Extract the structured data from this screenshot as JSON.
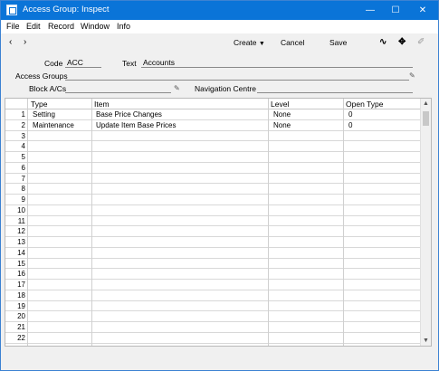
{
  "window": {
    "title": "Access Group: Inspect"
  },
  "menu": [
    "File",
    "Edit",
    "Record",
    "Window",
    "Info"
  ],
  "toolbar": {
    "back": "‹",
    "forward": "›",
    "create": "Create",
    "cancel": "Cancel",
    "save": "Save"
  },
  "form": {
    "code_label": "Code",
    "code_value": "ACC",
    "text_label": "Text",
    "text_value": "Accounts",
    "access_groups_label": "Access Groups",
    "access_groups_value": "",
    "block_acs_label": "Block A/Cs",
    "block_acs_value": "",
    "navigation_centre_label": "Navigation Centre",
    "navigation_centre_value": ""
  },
  "grid": {
    "columns": [
      "Type",
      "Item",
      "Level",
      "Open Type"
    ],
    "rows": [
      {
        "n": "1",
        "type": "Setting",
        "item": "Base Price Changes",
        "level": "None",
        "open_type": "0"
      },
      {
        "n": "2",
        "type": "Maintenance",
        "item": "Update Item Base Prices",
        "level": "None",
        "open_type": "0"
      },
      {
        "n": "3"
      },
      {
        "n": "4"
      },
      {
        "n": "5"
      },
      {
        "n": "6"
      },
      {
        "n": "7"
      },
      {
        "n": "8"
      },
      {
        "n": "9"
      },
      {
        "n": "10"
      },
      {
        "n": "11"
      },
      {
        "n": "12"
      },
      {
        "n": "13"
      },
      {
        "n": "14"
      },
      {
        "n": "15"
      },
      {
        "n": "16"
      },
      {
        "n": "17"
      },
      {
        "n": "18"
      },
      {
        "n": "19"
      },
      {
        "n": "20"
      },
      {
        "n": "21"
      },
      {
        "n": "22"
      }
    ]
  }
}
